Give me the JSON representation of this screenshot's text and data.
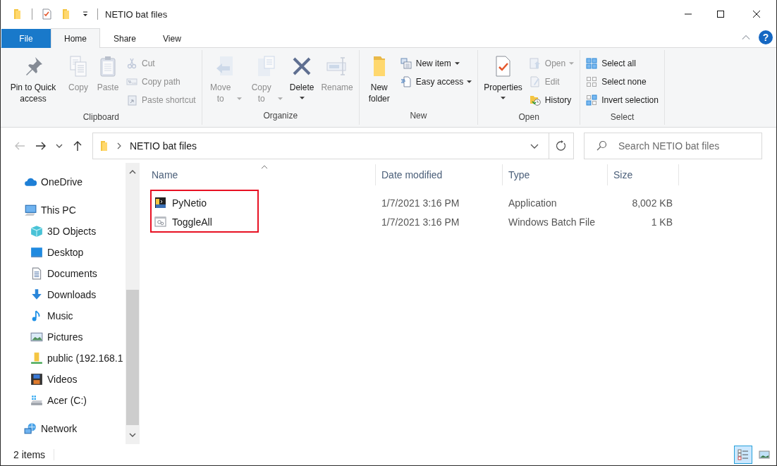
{
  "window": {
    "title": "NETIO bat files"
  },
  "ribbon": {
    "tabs": [
      {
        "label": "File",
        "kind": "file",
        "selected": false
      },
      {
        "label": "Home",
        "kind": "tab",
        "selected": true
      },
      {
        "label": "Share",
        "kind": "tab",
        "selected": false
      },
      {
        "label": "View",
        "kind": "tab",
        "selected": false
      }
    ],
    "help": "?",
    "groups": [
      {
        "label": "Clipboard",
        "items": [
          {
            "kind": "large",
            "label": "Pin to Quick access",
            "disabled": false,
            "dropdown": false
          },
          {
            "kind": "large",
            "label": "Copy",
            "disabled": true,
            "dropdown": false
          },
          {
            "kind": "large",
            "label": "Paste",
            "disabled": true,
            "dropdown": false
          },
          {
            "kind": "stack",
            "items": [
              {
                "label": "Cut",
                "disabled": true,
                "dropdown": false
              },
              {
                "label": "Copy path",
                "disabled": true,
                "dropdown": false
              },
              {
                "label": "Paste shortcut",
                "disabled": true,
                "dropdown": false
              }
            ]
          }
        ]
      },
      {
        "label": "Organize",
        "items": [
          {
            "kind": "large",
            "label": "Move to",
            "disabled": true,
            "dropdown": true
          },
          {
            "kind": "large",
            "label": "Copy to",
            "disabled": true,
            "dropdown": true
          },
          {
            "kind": "large",
            "label": "Delete",
            "disabled": false,
            "dropdown": true
          },
          {
            "kind": "large",
            "label": "Rename",
            "disabled": true,
            "dropdown": false
          }
        ]
      },
      {
        "label": "New",
        "items": [
          {
            "kind": "large",
            "label": "New folder",
            "disabled": false,
            "dropdown": false
          },
          {
            "kind": "stack",
            "items": [
              {
                "label": "New item",
                "disabled": false,
                "dropdown": true
              },
              {
                "label": "Easy access",
                "disabled": false,
                "dropdown": true
              }
            ]
          }
        ]
      },
      {
        "label": "Open",
        "items": [
          {
            "kind": "large",
            "label": "Properties",
            "disabled": false,
            "dropdown": true
          },
          {
            "kind": "stack",
            "items": [
              {
                "label": "Open",
                "disabled": true,
                "dropdown": true
              },
              {
                "label": "Edit",
                "disabled": true,
                "dropdown": false
              },
              {
                "label": "History",
                "disabled": false,
                "dropdown": false
              }
            ]
          }
        ]
      },
      {
        "label": "Select",
        "items": [
          {
            "kind": "stack",
            "items": [
              {
                "label": "Select all",
                "disabled": false,
                "dropdown": false
              },
              {
                "label": "Select none",
                "disabled": false,
                "dropdown": false
              },
              {
                "label": "Invert selection",
                "disabled": false,
                "dropdown": false
              }
            ]
          }
        ]
      }
    ]
  },
  "address_bar": {
    "back": {
      "disabled": true
    },
    "forward": {
      "disabled": false
    },
    "up": {
      "disabled": false
    },
    "path": [
      "NETIO bat files"
    ],
    "search": {
      "placeholder": "Search NETIO bat files"
    }
  },
  "navigation_pane": {
    "items": [
      {
        "label": "OneDrive"
      },
      {
        "label": "This PC",
        "children": [
          {
            "label": "3D Objects"
          },
          {
            "label": "Desktop"
          },
          {
            "label": "Documents"
          },
          {
            "label": "Downloads"
          },
          {
            "label": "Music"
          },
          {
            "label": "Pictures"
          },
          {
            "label": "public (192.168.1"
          },
          {
            "label": "Videos"
          },
          {
            "label": "Acer (C:)"
          }
        ]
      },
      {
        "label": "Network"
      }
    ]
  },
  "file_list": {
    "columns": [
      {
        "label": "Name",
        "sorted": true
      },
      {
        "label": "Date modified",
        "sorted": false
      },
      {
        "label": "Type",
        "sorted": false
      },
      {
        "label": "Size",
        "sorted": false
      }
    ],
    "rows": [
      {
        "name": "PyNetio",
        "date_modified": "1/7/2021 3:16 PM",
        "type": "Application",
        "size": "8,002 KB",
        "selected": false
      },
      {
        "name": "ToggleAll",
        "date_modified": "1/7/2021 3:16 PM",
        "type": "Windows Batch File",
        "size": "1 KB",
        "selected": false
      }
    ],
    "name_highlight": true
  },
  "status_bar": {
    "item_count": "2 items",
    "views": [
      {
        "kind": "details",
        "selected": true
      },
      {
        "kind": "large_icons",
        "selected": false
      }
    ]
  }
}
